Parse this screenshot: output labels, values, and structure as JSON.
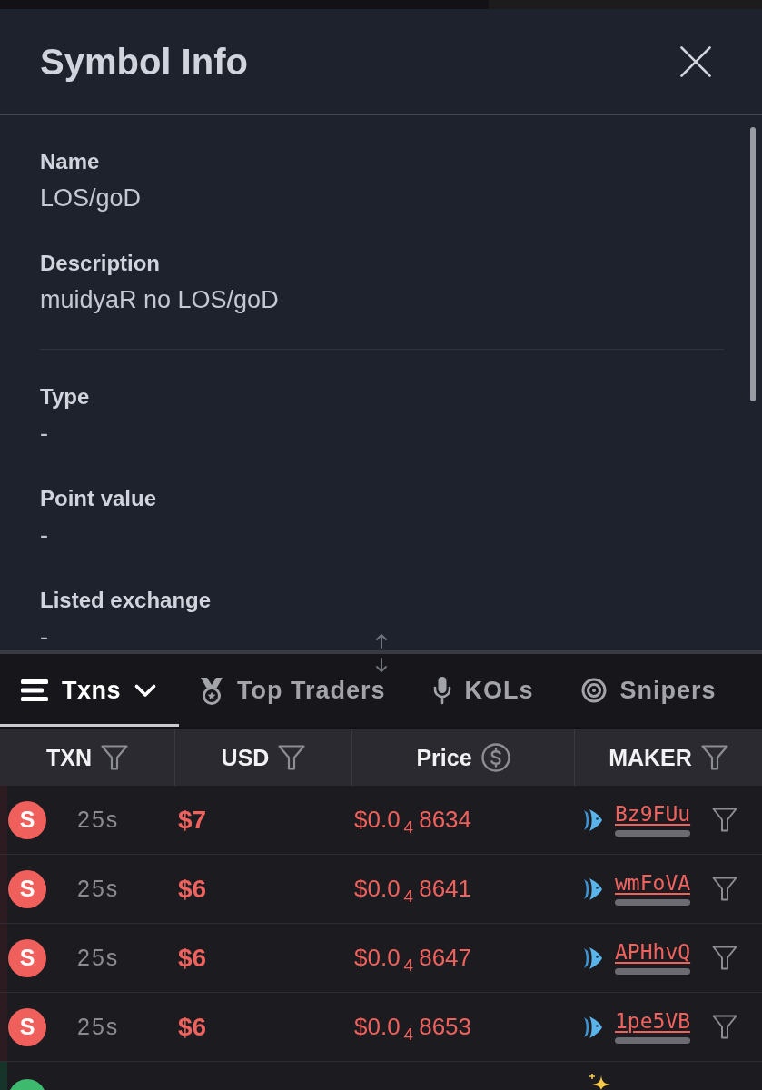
{
  "dialog": {
    "title": "Symbol Info",
    "sections": [
      {
        "fields": [
          {
            "label": "Name",
            "value": "LOS/goD"
          },
          {
            "label": "Description",
            "value": "muidyaR no LOS/goD"
          }
        ]
      },
      {
        "fields": [
          {
            "label": "Type",
            "value": "-"
          },
          {
            "label": "Point value",
            "value": "-"
          },
          {
            "label": "Listed exchange",
            "value": "-"
          }
        ]
      }
    ]
  },
  "tabs": [
    {
      "label": "Txns",
      "selected": true,
      "dropdown": true
    },
    {
      "label": "Top Traders",
      "selected": false,
      "dropdown": false
    },
    {
      "label": "KOLs",
      "selected": false,
      "dropdown": false
    },
    {
      "label": "Snipers",
      "selected": false,
      "dropdown": false
    }
  ],
  "table": {
    "columns": [
      {
        "label": "TXN",
        "kind": "filter"
      },
      {
        "label": "USD",
        "kind": "filter"
      },
      {
        "label": "Price",
        "kind": "currency"
      },
      {
        "label": "MAKER",
        "kind": "filter"
      }
    ],
    "rows": [
      {
        "kind": "sell",
        "badge": "S",
        "age": "25s",
        "usd": "$7",
        "price": "$0.0$_{4}$8634",
        "maker": {
          "address": "Bz9FUu",
          "kind": "fish"
        }
      },
      {
        "kind": "sell",
        "badge": "S",
        "age": "25s",
        "usd": "$6",
        "price": "$0.0$_{4}$8641",
        "maker": {
          "address": "wmFoVA",
          "kind": "fish"
        }
      },
      {
        "kind": "sell",
        "badge": "S",
        "age": "25s",
        "usd": "$6",
        "price": "$0.0$_{4}$8647",
        "maker": {
          "address": "APHhvQ",
          "kind": "fish"
        }
      },
      {
        "kind": "sell",
        "badge": "S",
        "age": "25s",
        "usd": "$6",
        "price": "$0.0$_{4}$8653",
        "maker": {
          "address": "1pe5VB",
          "kind": "fish"
        }
      }
    ],
    "partial_row": {
      "kind": "buy",
      "maker": {
        "kind": "sparkle"
      }
    }
  }
}
